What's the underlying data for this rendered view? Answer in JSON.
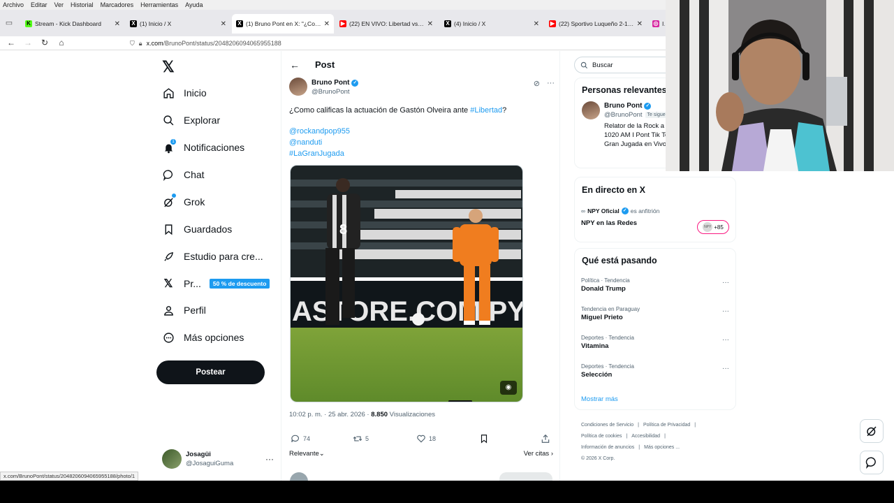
{
  "menubar": [
    "Archivo",
    "Editar",
    "Ver",
    "Historial",
    "Marcadores",
    "Herramientas",
    "Ayuda"
  ],
  "tabs": [
    {
      "title": "Stream - Kick Dashboard",
      "icon": "kick-favicon",
      "active": false,
      "color": "#53fc18"
    },
    {
      "title": "(1) Inicio / X",
      "icon": "x-favicon",
      "active": false,
      "color": "#000000"
    },
    {
      "title": "(1) Bruno Pont en X: \"¿Como ca",
      "icon": "x-favicon",
      "active": true,
      "color": "#000000"
    },
    {
      "title": "(22) EN VIVO: Libertad vs. Olim",
      "icon": "youtube-favicon",
      "active": false,
      "color": "#ff0000"
    },
    {
      "title": "(4) Inicio / X",
      "icon": "x-favicon",
      "active": false,
      "color": "#000000"
    },
    {
      "title": "(22) Sportivo Luqueño 2-1 Spor",
      "icon": "youtube-favicon",
      "active": false,
      "color": "#ff0000"
    },
    {
      "title": "In",
      "icon": "instagram-favicon",
      "active": false,
      "color": "#d6249f"
    }
  ],
  "url": {
    "host": "x.com",
    "path": "/BrunoPont/status/2048206094065955188"
  },
  "leftnav": {
    "items": [
      {
        "label": "Inicio",
        "icon": "home-icon"
      },
      {
        "label": "Explorar",
        "icon": "search-icon"
      },
      {
        "label": "Notificaciones",
        "icon": "bell-icon",
        "badge": "1"
      },
      {
        "label": "Chat",
        "icon": "chat-icon"
      },
      {
        "label": "Grok",
        "icon": "grok-icon"
      },
      {
        "label": "Guardados",
        "icon": "bookmark-icon"
      },
      {
        "label": "Estudio para cre...",
        "icon": "rocket-icon"
      },
      {
        "label": "Pr...",
        "icon": "x-premium-icon",
        "promo": "50 % de descuento"
      },
      {
        "label": "Perfil",
        "icon": "person-icon"
      },
      {
        "label": "Más opciones",
        "icon": "more-circle-icon"
      }
    ],
    "post_button": "Postear",
    "account": {
      "name": "Josagüi",
      "handle": "@JosaguiGuma",
      "more": "···"
    }
  },
  "post": {
    "header_title": "Post",
    "author_name": "Bruno Pont",
    "author_handle": "@BrunoPont",
    "text_prefix": "¿Como calificas la actuación de Gastón Olveira ante ",
    "text_hashtag": "#Libertad",
    "text_suffix": "?",
    "links": [
      "@rockandpop955",
      "@nanduti",
      "#LaGranJugada"
    ],
    "image_banner_text": "ASTORE.COM.PY",
    "image_player_number": "8",
    "time": "10:02 p. m. · 25 abr. 2026 · ",
    "views_count": "8.850",
    "views_label": " Visualizaciones",
    "replies": "74",
    "reposts": "5",
    "likes": "18",
    "sort_label": "Relevante",
    "quotes_label": "Ver citas"
  },
  "right": {
    "search_placeholder": "Buscar",
    "relevant_title": "Personas relevantes",
    "relevant_person": {
      "name": "Bruno Pont",
      "handle": "@BrunoPont",
      "follows_you": "Te sigue",
      "bio": "Relator de la Rock a Ñanduti 1020 AM I Pont Tik Tok BrunoI Gran Jugada en Vivo"
    },
    "live_title": "En directo en X",
    "live_host_name": "NPY Oficial",
    "live_host_suffix": "es anfitrión",
    "live_event": "NPY en las Redes",
    "live_avatar_text": "NPY",
    "live_count": "+85",
    "trends_title": "Qué está pasando",
    "trends": [
      {
        "context": "Política · Tendencia",
        "name": "Donald Trump"
      },
      {
        "context": "Tendencia en Paraguay",
        "name": "Miguel Prieto"
      },
      {
        "context": "Deportes · Tendencia",
        "name": "Vitamina"
      },
      {
        "context": "Deportes · Tendencia",
        "name": "Selección"
      }
    ],
    "show_more": "Mostrar más",
    "footer": [
      "Condiciones de Servicio",
      "|",
      "Política de Privacidad",
      "|",
      "Política de cookies",
      "|",
      "Accesibilidad",
      "|",
      "Información de anuncios",
      "|",
      "Más opciones ...",
      "© 2026 X Corp."
    ]
  },
  "statusbar": "x.com/BrunoPont/status/2048206094065955188/photo/1",
  "colors": {
    "accent": "#1d9bf0",
    "text": "#0f1419",
    "muted": "#536471",
    "live_pink": "#f91880"
  }
}
